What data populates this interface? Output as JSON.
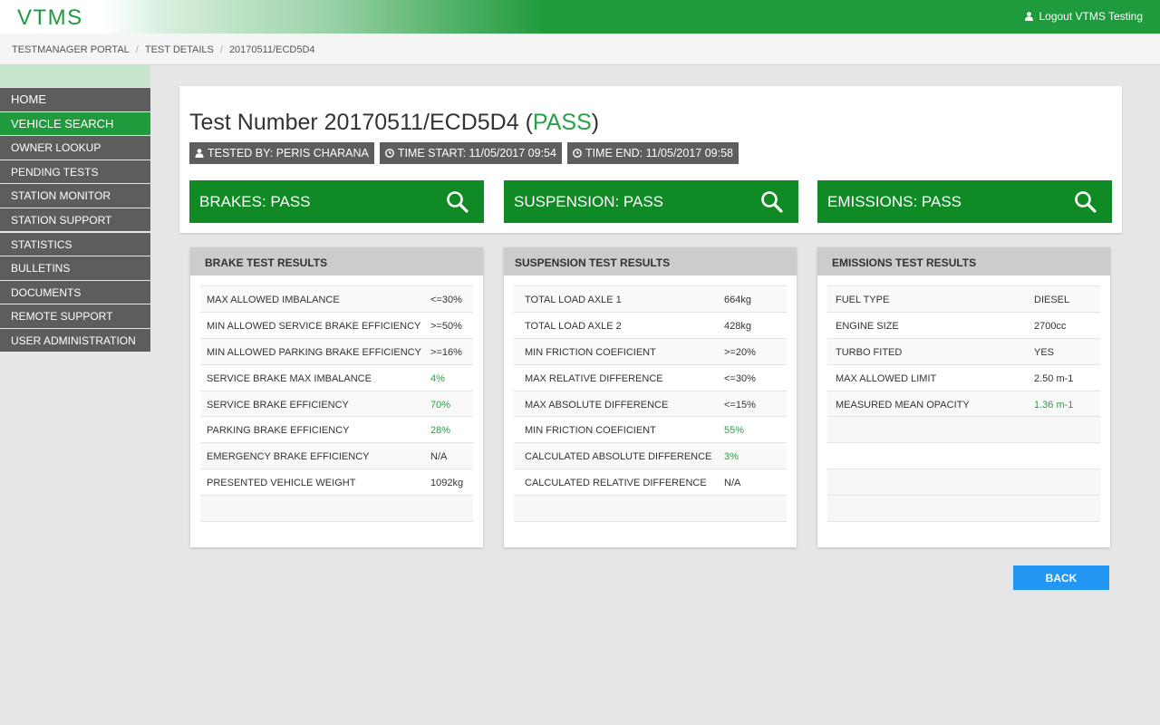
{
  "header": {
    "logo": "VTMS",
    "logout_label": "Logout VTMS Testing"
  },
  "breadcrumb": [
    "TESTMANAGER PORTAL",
    "TEST DETAILS",
    "20170511/ECD5D4"
  ],
  "sidebar": {
    "items": [
      {
        "label": "HOME"
      },
      {
        "label": "VEHICLE SEARCH"
      },
      {
        "label": "OWNER LOOKUP"
      },
      {
        "label": "PENDING TESTS"
      },
      {
        "label": "STATION MONITOR"
      },
      {
        "label": "STATION SUPPORT"
      },
      {
        "label": "STATISTICS"
      },
      {
        "label": "BULLETINS"
      },
      {
        "label": "DOCUMENTS"
      },
      {
        "label": "REMOTE SUPPORT"
      },
      {
        "label": "USER ADMINISTRATION"
      }
    ],
    "active": "VEHICLE SEARCH"
  },
  "test": {
    "title_prefix": "Test Number 20170511/ECD5D4 (",
    "result": "PASS",
    "title_suffix": ")",
    "tested_by": "TESTED BY: PERIS CHARANA",
    "time_start": "TIME START: 11/05/2017 09:54",
    "time_end": "TIME END: 11/05/2017 09:58"
  },
  "status": {
    "brakes": "BRAKES: PASS",
    "suspension": "SUSPENSION: PASS",
    "emissions": "EMISSIONS: PASS"
  },
  "brake_panel": {
    "title": "BRAKE TEST RESULTS",
    "rows": [
      {
        "label": "MAX ALLOWED IMBALANCE",
        "value": "<=30%"
      },
      {
        "label": "MIN ALLOWED SERVICE BRAKE EFFICIENCY",
        "value": ">=50%"
      },
      {
        "label": "MIN ALLOWED PARKING BRAKE EFFICIENCY",
        "value": ">=16%"
      },
      {
        "label": "SERVICE BRAKE MAX IMBALANCE",
        "value": "4%"
      },
      {
        "label": "SERVICE BRAKE EFFICIENCY",
        "value": "70%"
      },
      {
        "label": "PARKING BRAKE EFFICIENCY",
        "value": "28%"
      },
      {
        "label": "EMERGENCY BRAKE EFFICIENCY",
        "value": "N/A"
      },
      {
        "label": "PRESENTED VEHICLE WEIGHT",
        "value": "1092kg"
      }
    ]
  },
  "suspension_panel": {
    "title": "SUSPENSION TEST RESULTS",
    "rows": [
      {
        "label": "TOTAL LOAD AXLE 1",
        "value": "664kg"
      },
      {
        "label": "TOTAL LOAD AXLE 2",
        "value": "428kg"
      },
      {
        "label": "MIN FRICTION COEFICIENT",
        "value": ">=20%"
      },
      {
        "label": "MAX RELATIVE DIFFERENCE",
        "value": "<=30%"
      },
      {
        "label": "MAX ABSOLUTE DIFFERENCE",
        "value": "<=15%"
      },
      {
        "label": "MIN FRICTION COEFICIENT",
        "value": "55%"
      },
      {
        "label": "CALCULATED ABSOLUTE DIFFERENCE",
        "value": "3%"
      },
      {
        "label": "CALCULATED RELATIVE DIFFERENCE",
        "value": "N/A"
      }
    ]
  },
  "emissions_panel": {
    "title": "EMISSIONS TEST RESULTS",
    "rows": [
      {
        "label": "FUEL TYPE",
        "value": "DIESEL"
      },
      {
        "label": "ENGINE SIZE",
        "value": "2700cc"
      },
      {
        "label": "TURBO FITED",
        "value": "YES"
      },
      {
        "label": "MAX ALLOWED LIMIT",
        "value": "2.50 m-1"
      },
      {
        "label": "MEASURED MEAN OPACITY",
        "value": "1.36 m-1"
      }
    ]
  },
  "back_label": "BACK",
  "colors": {
    "brand_green": "#1f9a3c",
    "status_green": "#0f8a24",
    "pass_text": "#2aa046",
    "nav_gray": "#5d5d5d",
    "back_blue": "#2196f3"
  }
}
